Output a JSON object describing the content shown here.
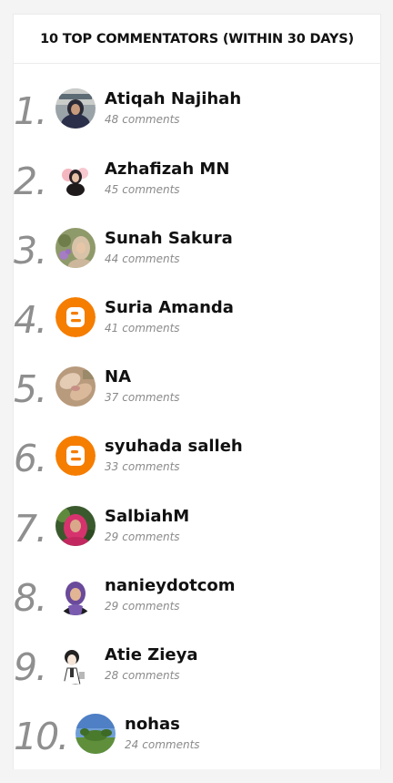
{
  "widget": {
    "title": "10 TOP COMMENTATORS (WITHIN 30 DAYS)",
    "count_suffix": "comments"
  },
  "commentators": [
    {
      "rank": "1.",
      "name": "Atiqah Najihah",
      "count": "48",
      "avatar": "photo-avatar-icon"
    },
    {
      "rank": "2.",
      "name": "Azhafizah MN",
      "count": "45",
      "avatar": "photo-avatar-icon"
    },
    {
      "rank": "3.",
      "name": "Sunah Sakura",
      "count": "44",
      "avatar": "photo-avatar-icon"
    },
    {
      "rank": "4.",
      "name": "Suria Amanda",
      "count": "41",
      "avatar": "blogger-logo-icon"
    },
    {
      "rank": "5.",
      "name": "NA",
      "count": "37",
      "avatar": "photo-avatar-icon"
    },
    {
      "rank": "6.",
      "name": "syuhada salleh",
      "count": "33",
      "avatar": "blogger-logo-icon"
    },
    {
      "rank": "7.",
      "name": "SalbiahM",
      "count": "29",
      "avatar": "photo-avatar-icon"
    },
    {
      "rank": "8.",
      "name": "nanieydotcom",
      "count": "29",
      "avatar": "photo-avatar-icon"
    },
    {
      "rank": "9.",
      "name": "Atie Zieya",
      "count": "28",
      "avatar": "photo-avatar-icon"
    },
    {
      "rank": "10.",
      "name": "nohas",
      "count": "24",
      "avatar": "photo-avatar-icon"
    }
  ],
  "colors": {
    "blogger_orange": "#f57d00",
    "rank_gray": "#8f8f8f",
    "count_gray": "#8a8a8a"
  }
}
